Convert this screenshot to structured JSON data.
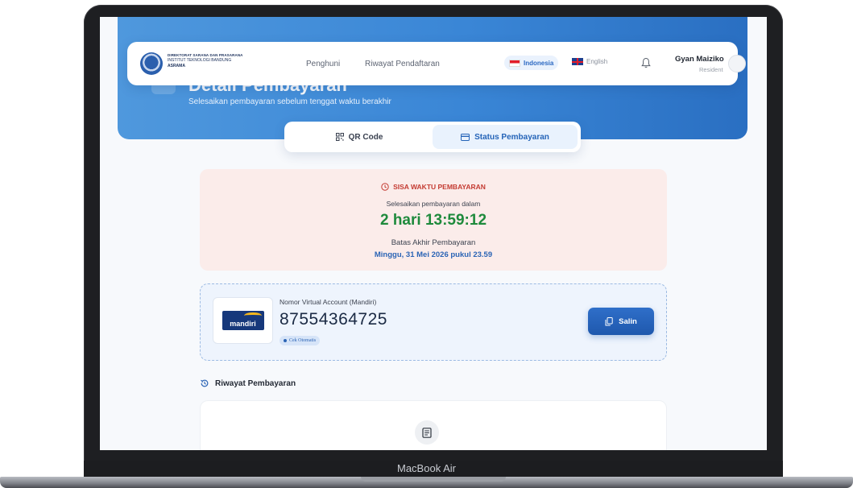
{
  "device": {
    "brand": "MacBook Air"
  },
  "header": {
    "logo": {
      "line1": "DIREKTORAT SARANA DAN PRASARANA",
      "line2": "INSTITUT TEKNOLOGI BANDUNG",
      "line3": "ASRAMA"
    },
    "nav": [
      {
        "label": "Penghuni"
      },
      {
        "label": "Riwayat Pendaftaran"
      }
    ],
    "languages": {
      "active": "Indonesia",
      "other": "English"
    },
    "user": {
      "name": "Gyan Maiziko",
      "role": "Resident"
    }
  },
  "hero": {
    "title": "Detail Pembayaran",
    "subtitle": "Selesaikan pembayaran sebelum tenggat waktu berakhir"
  },
  "tabs": [
    {
      "label": "QR Code",
      "icon": "qr-icon",
      "active": false
    },
    {
      "label": "Status Pembayaran",
      "icon": "card-icon",
      "active": true
    }
  ],
  "timer": {
    "heading": "SISA WAKTU PEMBAYARAN",
    "subtitle": "Selesaikan pembayaran dalam",
    "countdown": "2 hari 13:59:12",
    "deadline_label": "Batas Akhir Pembayaran",
    "deadline_value": "Minggu, 31 Mei 2026 pukul 23.59"
  },
  "virtual_account": {
    "bank_logo_text": "mandiri",
    "label": "Nomor Virtual Account (Mandiri)",
    "number": "87554364725",
    "badge": "Cek Otomatis",
    "copy_label": "Salin"
  },
  "history": {
    "title": "Riwayat Pembayaran"
  },
  "colors": {
    "primary": "#2b68c2",
    "hero_start": "#4f98dd",
    "hero_end": "#2a6fc2",
    "danger": "#c43b32",
    "success": "#1e8a3c"
  }
}
